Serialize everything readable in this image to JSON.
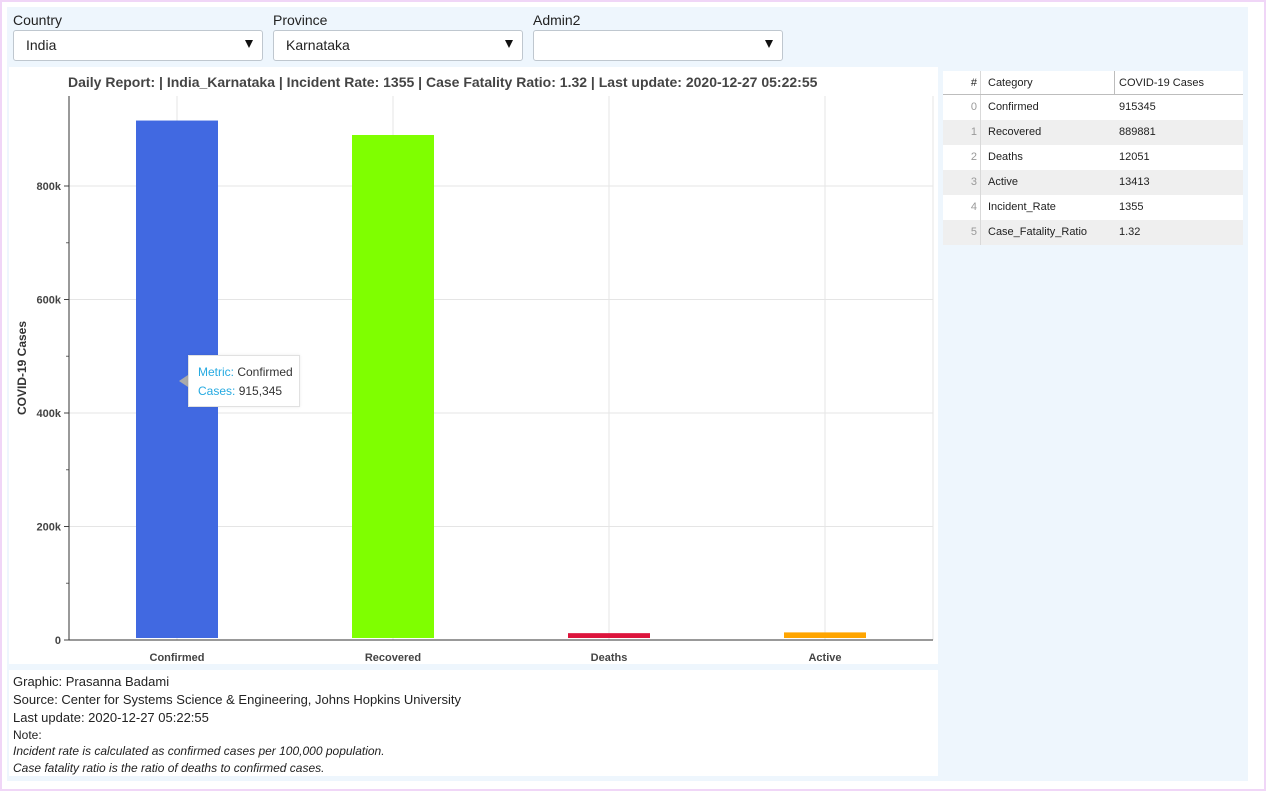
{
  "filters": {
    "country": {
      "label": "Country",
      "value": "India"
    },
    "province": {
      "label": "Province",
      "value": "Karnataka"
    },
    "admin2": {
      "label": "Admin2",
      "value": ""
    }
  },
  "colors": {
    "confirmed": "#4169e1",
    "recovered": "#7fff00",
    "deaths": "#dc143c",
    "active": "#ffa500"
  },
  "chart_data": {
    "type": "bar",
    "title": "Daily Report: | India_Karnataka | Incident Rate: 1355 | Case Fatality Ratio: 1.32 | Last update: 2020-12-27 05:22:55",
    "xlabel": "",
    "ylabel": "COVID-19 Cases",
    "categories": [
      "Confirmed",
      "Recovered",
      "Deaths",
      "Active"
    ],
    "values": [
      915345,
      889881,
      12051,
      13413
    ],
    "ylim": [
      0,
      960000
    ],
    "yticks": [
      0,
      200000,
      400000,
      600000,
      800000
    ],
    "ytick_labels": [
      "0",
      "200k",
      "400k",
      "600k",
      "800k"
    ],
    "grid": true,
    "legend": "none"
  },
  "tooltip": {
    "metric_key": "Metric:",
    "metric_value": "Confirmed",
    "cases_key": "Cases:",
    "cases_value": "915,345"
  },
  "table": {
    "headers": [
      "#",
      "Category",
      "COVID-19 Cases"
    ],
    "rows": [
      {
        "idx": "0",
        "category": "Confirmed",
        "value": "915345"
      },
      {
        "idx": "1",
        "category": "Recovered",
        "value": "889881"
      },
      {
        "idx": "2",
        "category": "Deaths",
        "value": "12051"
      },
      {
        "idx": "3",
        "category": "Active",
        "value": "13413"
      },
      {
        "idx": "4",
        "category": "Incident_Rate",
        "value": "1355"
      },
      {
        "idx": "5",
        "category": "Case_Fatality_Ratio",
        "value": "1.32"
      }
    ]
  },
  "footer": {
    "graphic": "Graphic: Prasanna Badami",
    "source": "Source: Center for Systems Science & Engineering, Johns Hopkins University",
    "last_update": "Last update: 2020-12-27 05:22:55",
    "note_label": "Note:",
    "note1": "Incident rate is calculated as confirmed cases per 100,000 population.",
    "note2": "Case fatality ratio is the ratio of deaths to confirmed cases."
  }
}
